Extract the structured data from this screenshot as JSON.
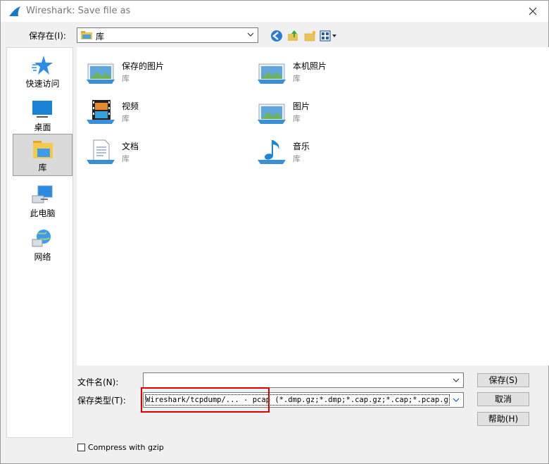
{
  "window": {
    "title": "Wireshark: Save file as"
  },
  "location": {
    "label": "保存在(I):",
    "value": "库"
  },
  "places": [
    {
      "label": "快速访问"
    },
    {
      "label": "桌面"
    },
    {
      "label": "库"
    },
    {
      "label": "此电脑"
    },
    {
      "label": "网络"
    }
  ],
  "files": [
    {
      "name": "保存的图片",
      "type": "库"
    },
    {
      "name": "本机照片",
      "type": "库"
    },
    {
      "name": "视频",
      "type": "库"
    },
    {
      "name": "图片",
      "type": "库"
    },
    {
      "name": "文档",
      "type": "库"
    },
    {
      "name": "音乐",
      "type": "库"
    }
  ],
  "filename": {
    "label": "文件名(N):",
    "value": ""
  },
  "filetype": {
    "label": "保存类型(T):",
    "value": "Wireshark/tcpdump/... - pcap (*.dmp.gz;*.dmp;*.cap.gz;*.cap;*.pcap.gz;*.pcap)"
  },
  "buttons": {
    "save": "保存(S)",
    "cancel": "取消",
    "help": "帮助(H)"
  },
  "options": {
    "gzip_label": "Compress with gzip",
    "gzip_checked": false
  },
  "colors": {
    "highlight_box": "#e00000",
    "selected_place": "#dadada"
  }
}
